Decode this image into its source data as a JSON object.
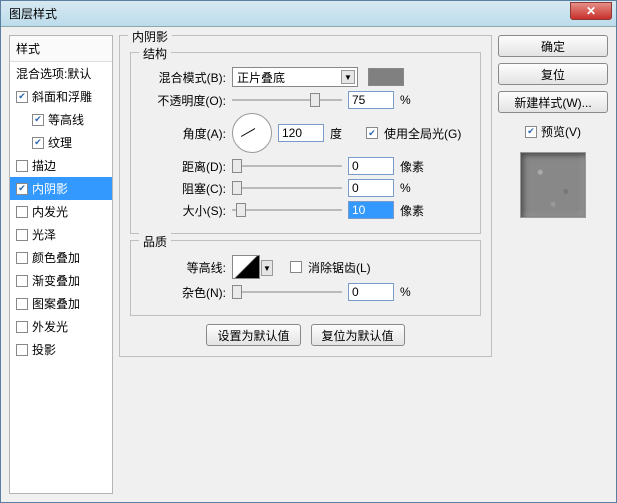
{
  "window": {
    "title": "图层样式"
  },
  "left": {
    "header": "样式",
    "blend_defaults": "混合选项:默认",
    "items": [
      {
        "label": "斜面和浮雕",
        "checked": true
      },
      {
        "label": "等高线",
        "checked": true,
        "indent": true
      },
      {
        "label": "纹理",
        "checked": true,
        "indent": true
      },
      {
        "label": "描边",
        "checked": false
      },
      {
        "label": "内阴影",
        "checked": true,
        "selected": true
      },
      {
        "label": "内发光",
        "checked": false
      },
      {
        "label": "光泽",
        "checked": false
      },
      {
        "label": "颜色叠加",
        "checked": false
      },
      {
        "label": "渐变叠加",
        "checked": false
      },
      {
        "label": "图案叠加",
        "checked": false
      },
      {
        "label": "外发光",
        "checked": false
      },
      {
        "label": "投影",
        "checked": false
      }
    ]
  },
  "panel": {
    "title": "内阴影",
    "structure": {
      "legend": "结构",
      "blend_mode_label": "混合模式(B):",
      "blend_mode_value": "正片叠底",
      "opacity_label": "不透明度(O):",
      "opacity_value": "75",
      "opacity_unit": "%",
      "angle_label": "角度(A):",
      "angle_value": "120",
      "angle_unit": "度",
      "global_light_label": "使用全局光(G)",
      "global_light_checked": true,
      "distance_label": "距离(D):",
      "distance_value": "0",
      "distance_unit": "像素",
      "choke_label": "阻塞(C):",
      "choke_value": "0",
      "choke_unit": "%",
      "size_label": "大小(S):",
      "size_value": "10",
      "size_unit": "像素"
    },
    "quality": {
      "legend": "品质",
      "contour_label": "等高线:",
      "antialias_label": "消除锯齿(L)",
      "antialias_checked": false,
      "noise_label": "杂色(N):",
      "noise_value": "0",
      "noise_unit": "%"
    },
    "buttons": {
      "make_default": "设置为默认值",
      "reset_default": "复位为默认值"
    }
  },
  "right": {
    "ok": "确定",
    "cancel": "复位",
    "new_style": "新建样式(W)...",
    "preview_label": "预览(V)",
    "preview_checked": true
  }
}
